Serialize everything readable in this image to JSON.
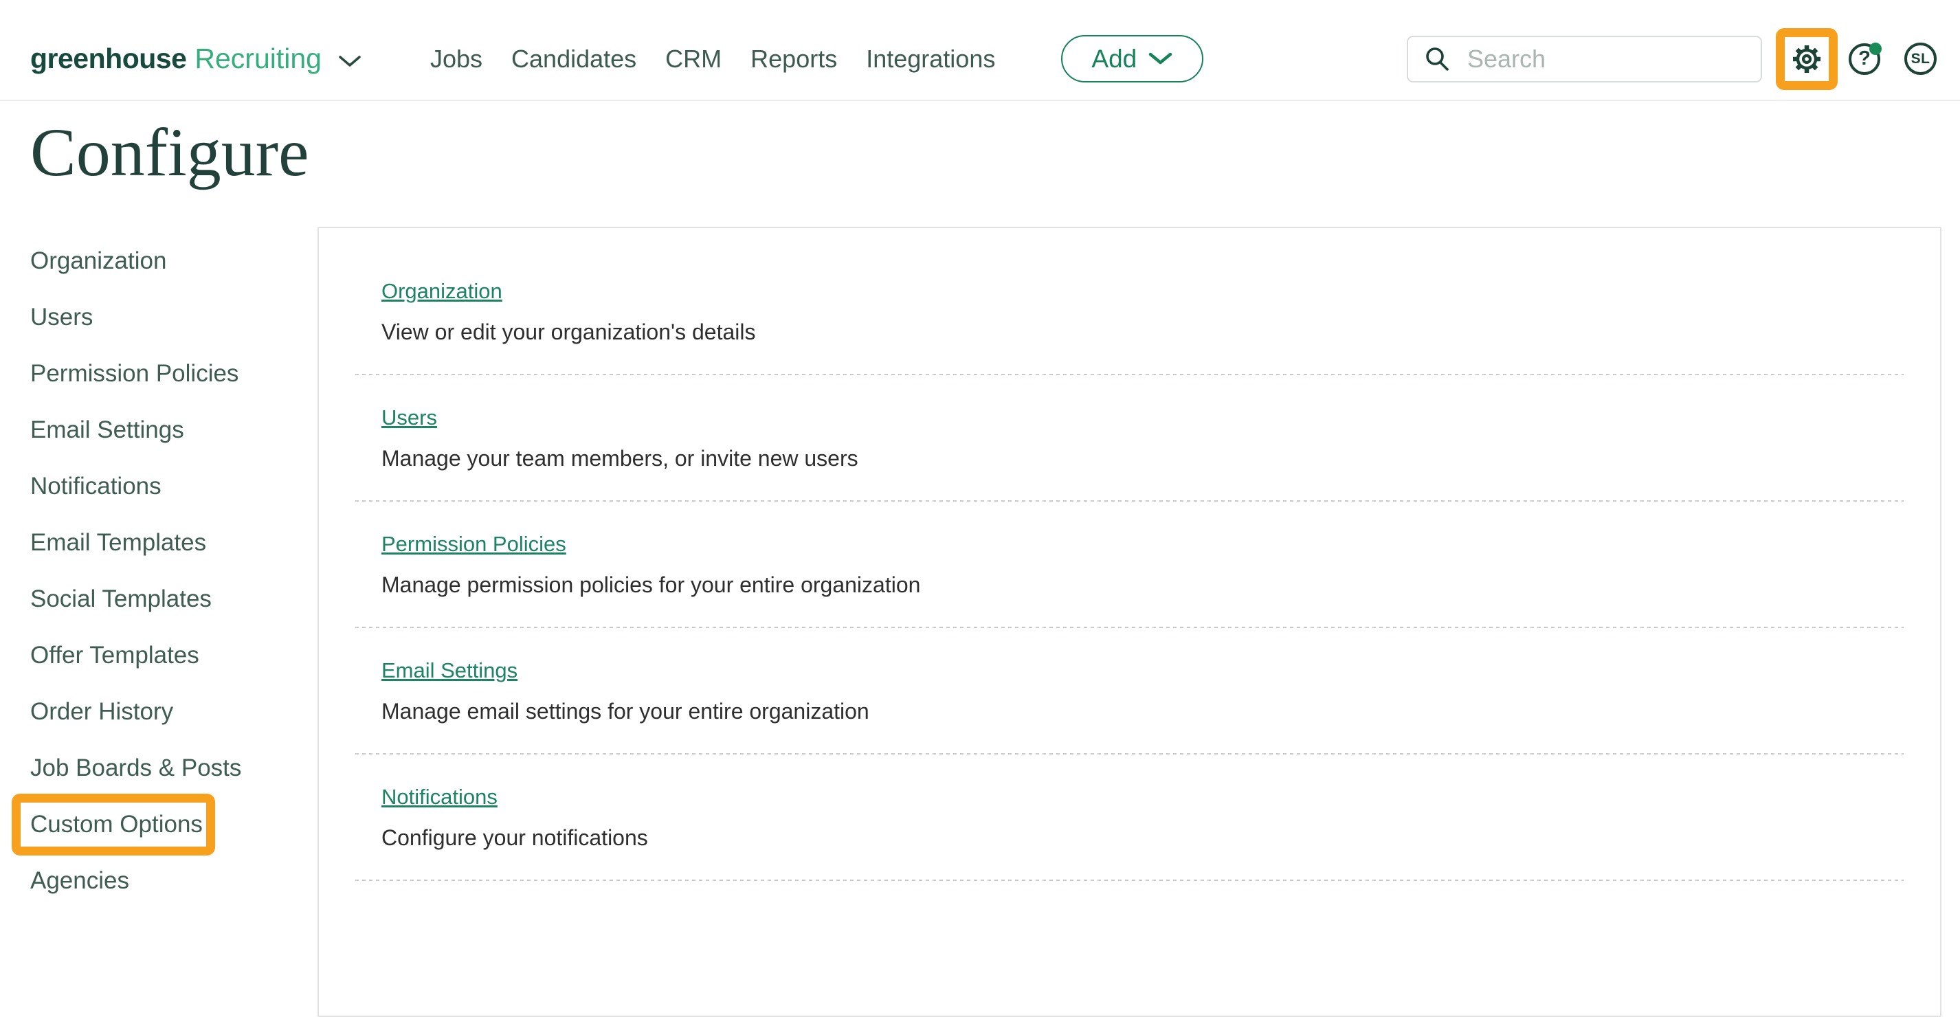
{
  "brand": {
    "name": "greenhouse",
    "product": "Recruiting"
  },
  "nav": {
    "items": [
      "Jobs",
      "Candidates",
      "CRM",
      "Reports",
      "Integrations"
    ]
  },
  "toolbar": {
    "add_label": "Add"
  },
  "search": {
    "placeholder": "Search"
  },
  "user": {
    "initials": "SL"
  },
  "icons": [
    "chevron-down-icon",
    "search-icon",
    "gear-icon",
    "help-icon",
    "avatar"
  ],
  "page": {
    "title": "Configure"
  },
  "sidebar": {
    "items": [
      {
        "label": "Organization",
        "highlighted": false
      },
      {
        "label": "Users",
        "highlighted": false
      },
      {
        "label": "Permission Policies",
        "highlighted": false
      },
      {
        "label": "Email Settings",
        "highlighted": false
      },
      {
        "label": "Notifications",
        "highlighted": false
      },
      {
        "label": "Email Templates",
        "highlighted": false
      },
      {
        "label": "Social Templates",
        "highlighted": false
      },
      {
        "label": "Offer Templates",
        "highlighted": false
      },
      {
        "label": "Order History",
        "highlighted": false
      },
      {
        "label": "Job Boards & Posts",
        "highlighted": false
      },
      {
        "label": "Custom Options",
        "highlighted": true
      },
      {
        "label": "Agencies",
        "highlighted": false
      }
    ]
  },
  "main": {
    "sections": [
      {
        "link": "Organization",
        "description": "View or edit your organization's details"
      },
      {
        "link": "Users",
        "description": "Manage your team members, or invite new users"
      },
      {
        "link": "Permission Policies",
        "description": "Manage permission policies for your entire organization"
      },
      {
        "link": "Email Settings",
        "description": "Manage email settings for your entire organization"
      },
      {
        "link": "Notifications",
        "description": "Configure your notifications"
      }
    ]
  },
  "colors": {
    "brand_dark_green": "#17493c",
    "brand_light_green": "#35ae7e",
    "nav_text": "#3d5a50",
    "action_green": "#16835a",
    "link_green": "#1d8460",
    "icon_dark": "#1d4237",
    "badge_green": "#1b8a58",
    "annotation_orange": "#f7a01e",
    "title_green": "#22413a",
    "sidebar_text": "#3e5c51",
    "description_text": "#2e2e2e"
  }
}
